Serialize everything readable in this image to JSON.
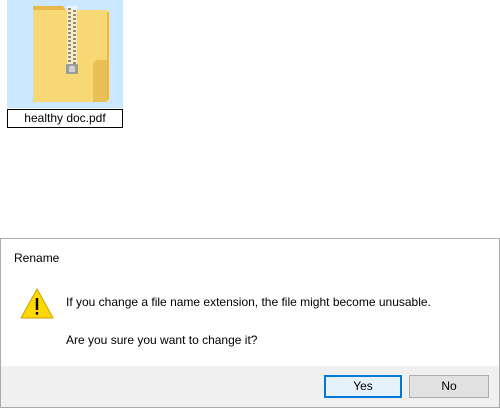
{
  "desktop": {
    "file": {
      "name": "healthy doc.pdf",
      "icon": "zip-folder-icon"
    }
  },
  "dialog": {
    "title": "Rename",
    "icon": "warning-icon",
    "message": "If you change a file name extension, the file might become unusable.",
    "question": "Are you sure you want to change it?",
    "buttons": {
      "yes": "Yes",
      "no": "No"
    }
  },
  "colors": {
    "selection": "#cce8ff",
    "default_button_border": "#0078d7",
    "footer": "#f0f0f0",
    "warning": "#ffd800"
  }
}
